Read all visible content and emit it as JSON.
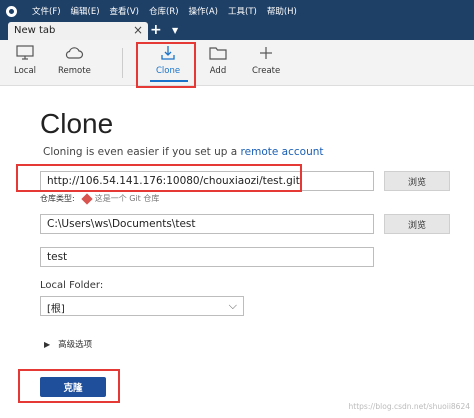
{
  "menu": [
    "文件(F)",
    "编辑(E)",
    "查看(V)",
    "仓库(R)",
    "操作(A)",
    "工具(T)",
    "帮助(H)"
  ],
  "tab": {
    "label": "New tab",
    "close": "×",
    "add": "+",
    "dropdown": "▼"
  },
  "toolbar": {
    "local": "Local",
    "remote": "Remote",
    "clone": "Clone",
    "add": "Add",
    "create": "Create"
  },
  "page": {
    "title": "Clone",
    "subtitle_prefix": "Cloning is even easier if you set up a ",
    "subtitle_link": "remote account"
  },
  "form": {
    "url_value": "http://106.54.141.176:10080/chouxiaozi/test.git",
    "browse_label": "浏览",
    "repo_type_label": "仓库类型:",
    "repo_type_hint": "这是一个 Git 仓库",
    "path_value": "C:\\Users\\ws\\Documents\\test",
    "name_value": "test",
    "local_folder_label": "Local Folder:",
    "local_folder_value": "[根]",
    "advanced_label": "高级选项",
    "clone_button": "克隆"
  },
  "watermark": "https://blog.csdn.net/shuoii8624",
  "colors": {
    "titlebar": "#1e3f66",
    "accent": "#1a73c8",
    "clone_button": "#1f4e9b",
    "highlight_box": "#e53935"
  },
  "icons": {
    "app": "sourcetree-logo-icon",
    "local": "monitor-icon",
    "remote": "cloud-icon",
    "clone": "download-tray-icon",
    "add": "folder-icon",
    "create": "plus-icon",
    "advanced": "caret-right-icon",
    "select": "chevron-down-icon"
  }
}
